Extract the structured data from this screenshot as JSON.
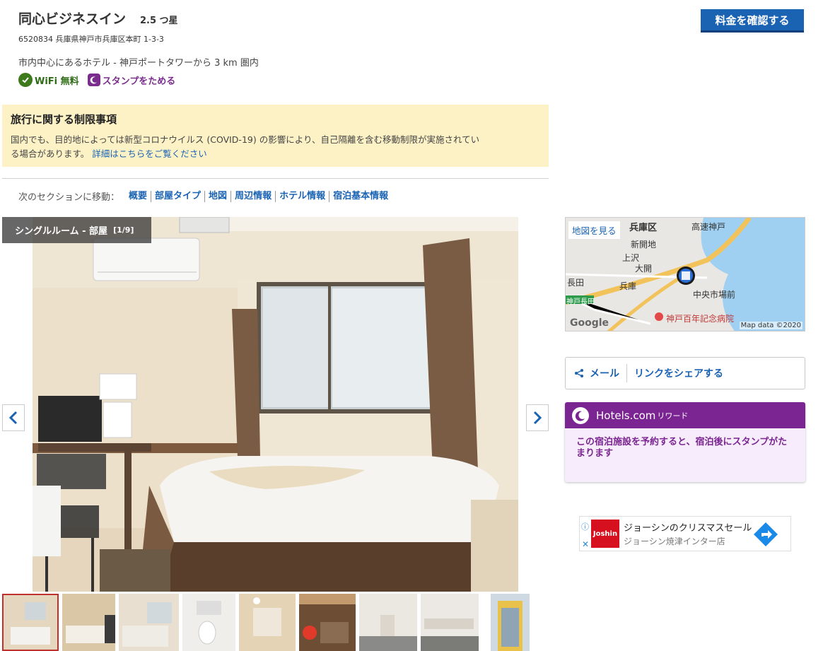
{
  "header": {
    "hotel_name": "同心ビジネスイン",
    "stars": "2.5 つ星",
    "address": "6520834 兵庫県神戸市兵庫区本町 1-3-3",
    "tagline": "市内中心にあるホテル - 神戸ポートタワーから 3 km 圏内",
    "wifi_label": "WiFi 無料",
    "stamp_label": "スタンプをためる",
    "price_button": "料金を確認する"
  },
  "notice": {
    "title": "旅行に関する制限事項",
    "body_line1": "国内でも、目的地によっては新型コロナウイルス (COVID-19) の影響により、自己隔離を含む移動制限が実施されてい",
    "body_line2": "る場合があります。",
    "link": "詳細はこちらをご覧ください"
  },
  "section_nav": {
    "label": "次のセクションに移動：",
    "items": [
      "概要",
      "部屋タイプ",
      "地図",
      "周辺情報",
      "ホテル情報",
      "宿泊基本情報"
    ]
  },
  "gallery": {
    "room_label": "シングルルーム - 部屋",
    "counter": "[1/9]"
  },
  "map": {
    "view_label": "地図を見る",
    "credit": "Map data ©2020",
    "google": "Google",
    "places": [
      "兵庫区",
      "高速神戸",
      "新開地",
      "上沢",
      "大開",
      "長田",
      "兵庫",
      "中央市場前",
      "神戸百年記念病院",
      "神戸長田"
    ]
  },
  "share": {
    "mail": "メール",
    "link": "リンクをシェアする"
  },
  "rewards": {
    "brand": "Hotels.com",
    "sub": "リワード",
    "body": "この宿泊施設を予約すると、宿泊後にスタンプがたまります"
  },
  "ad": {
    "logo": "Joshin",
    "title": "ジョーシンのクリスマスセール",
    "sub": "ジョーシン焼津インター店"
  },
  "colors": {
    "link": "#1a63b3",
    "brand_purple": "#7b2592",
    "notice_bg": "#fdf2c6",
    "wifi_green": "#3d7a1b"
  }
}
